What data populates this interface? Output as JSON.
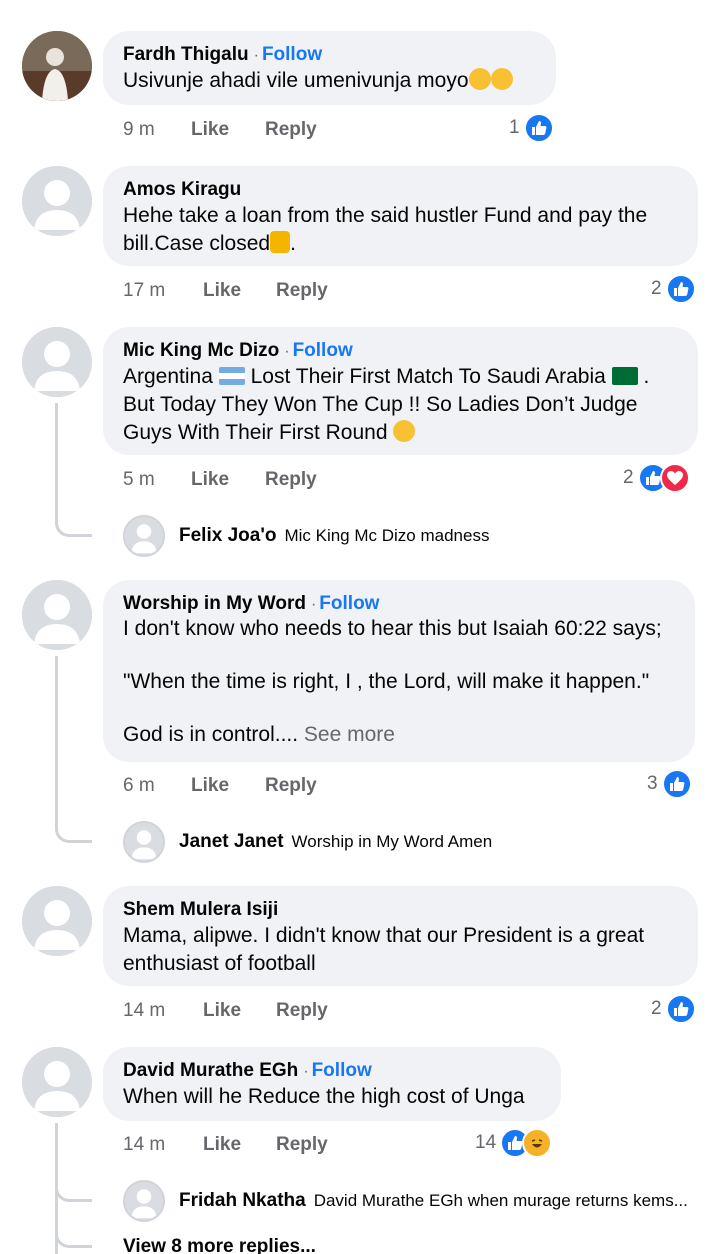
{
  "follow_label": "Follow",
  "dot": "·",
  "actions": {
    "like": "Like",
    "reply": "Reply"
  },
  "comments": [
    {
      "author": "Fardh Thigalu",
      "text": "Usivunje ahadi vile umenivunja moyo",
      "time": "9 m",
      "reactions": "1"
    },
    {
      "author": "Amos Kiragu",
      "text": "Hehe take a loan from the said hustler Fund and pay the bill.Case closed",
      "text_end": ".",
      "time": "17 m",
      "reactions": "2"
    },
    {
      "author": "Mic King Mc Dizo",
      "text_1": "Argentina",
      "text_2": "Lost Their First Match To Saudi Arabia",
      "text_3": ". But Today They Won The Cup !! So Ladies Don’t Judge Guys With Their First Round",
      "time": "5 m",
      "reactions": "2",
      "reply": {
        "author": "Felix Joa'o",
        "text": "Mic King Mc Dizo  madness"
      }
    },
    {
      "author": "Worship in My Word",
      "text": "I don't know who needs to hear this but Isaiah 60:22 says;\n\n\"When the time is right, I , the Lord, will make it happen.\"\n\nGod is in control.... ",
      "see_more": "See more",
      "time": "6 m",
      "reactions": "3",
      "reply": {
        "author": "Janet Janet",
        "text": "Worship in My Word Amen"
      }
    },
    {
      "author": "Shem Mulera Isiji",
      "text": "Mama, alipwe. I didn't know that our President is a great enthusiast of football",
      "time": "14 m",
      "reactions": "2"
    },
    {
      "author": "David Murathe EGh",
      "text": "When will he Reduce the high cost of Unga",
      "time": "14 m",
      "reactions": "14",
      "reply": {
        "author": "Fridah Nkatha",
        "text": "David Murathe EGh when murage returns kems..."
      },
      "view_more": "View 8 more replies..."
    }
  ]
}
